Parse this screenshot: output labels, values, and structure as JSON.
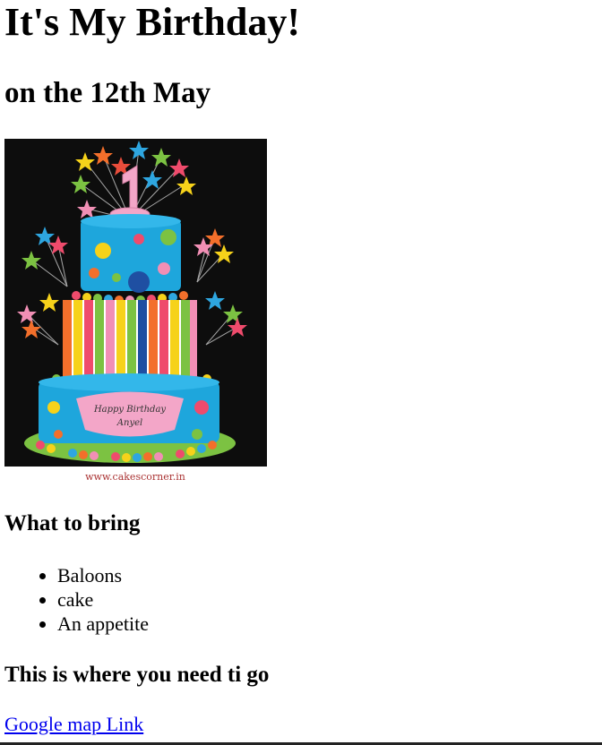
{
  "page": {
    "title": "It's My Birthday!",
    "subtitle": "on the 12th May"
  },
  "image": {
    "alt": "Birthday cake",
    "caption_text": "www.cakescorner.in",
    "plaque_line1": "Happy Birthday",
    "plaque_line2": "Anyel",
    "topper": "1"
  },
  "bring": {
    "heading": "What to bring",
    "items": [
      "Baloons",
      "cake",
      "An appetite"
    ]
  },
  "directions": {
    "heading": "This is where you need ti go",
    "link_text": "Google map Link"
  }
}
